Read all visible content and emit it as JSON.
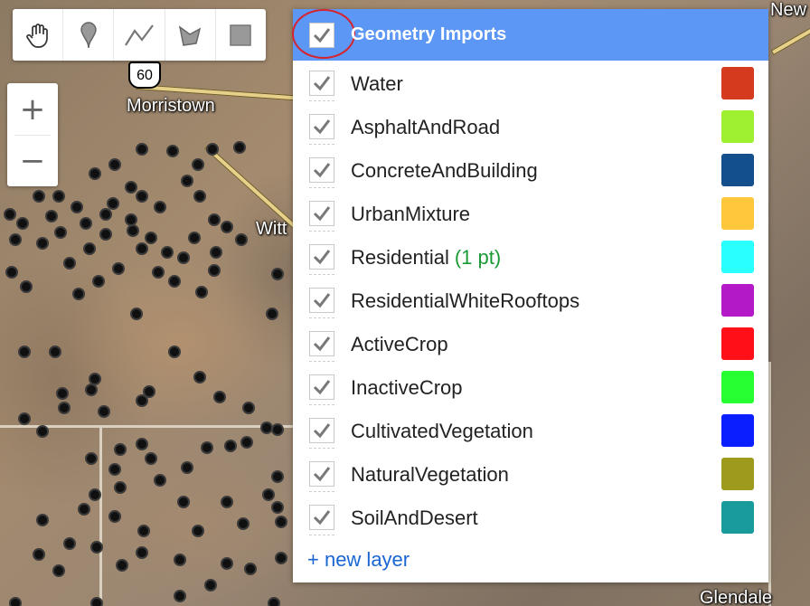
{
  "map": {
    "labels": {
      "morristown": "Morristown",
      "witt": "Witt",
      "new": "New",
      "glendale": "Glendale"
    },
    "shield": "60"
  },
  "toolbar": {
    "tools": [
      "pan-hand-icon",
      "point-marker-icon",
      "line-icon",
      "polygon-icon",
      "rectangle-icon"
    ]
  },
  "zoom": {
    "in": "+",
    "out": "−"
  },
  "panel": {
    "title": "Geometry Imports",
    "header_checked": true,
    "layers": [
      {
        "name": "Water",
        "points": "",
        "color": "#d63a1e",
        "checked": true
      },
      {
        "name": "AsphaltAndRoad",
        "points": "",
        "color": "#a0f032",
        "checked": true
      },
      {
        "name": "ConcreteAndBuilding",
        "points": "",
        "color": "#124f8c",
        "checked": true
      },
      {
        "name": "UrbanMixture",
        "points": "",
        "color": "#ffc83c",
        "checked": true
      },
      {
        "name": "Residential",
        "points": "(1 pt)",
        "color": "#2affff",
        "checked": true
      },
      {
        "name": "ResidentialWhiteRooftops",
        "points": "",
        "color": "#b419c8",
        "checked": true
      },
      {
        "name": "ActiveCrop",
        "points": "",
        "color": "#ff1019",
        "checked": true
      },
      {
        "name": "InactiveCrop",
        "points": "",
        "color": "#28ff32",
        "checked": true
      },
      {
        "name": "CultivatedVegetation",
        "points": "",
        "color": "#0a1eff",
        "checked": true
      },
      {
        "name": "NaturalVegetation",
        "points": "",
        "color": "#9e9a1e",
        "checked": true
      },
      {
        "name": "SoilAndDesert",
        "points": "",
        "color": "#199b9b",
        "checked": true
      }
    ],
    "new_layer": "+ new layer"
  }
}
